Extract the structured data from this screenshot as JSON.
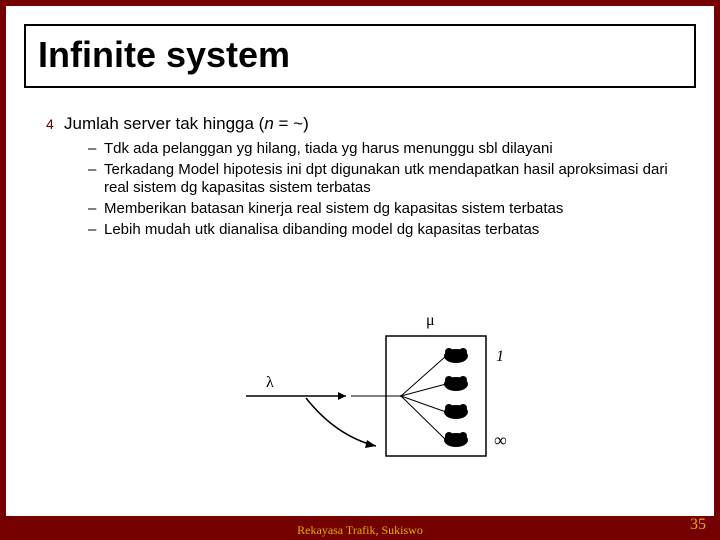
{
  "title": "Infinite system",
  "main_bullet": {
    "prefix": "Jumlah server tak hingga (",
    "varname": "n",
    "suffix": " = ~)"
  },
  "sub_bullets": [
    "Tdk ada pelanggan yg hilang, tiada yg harus menunggu sbl dilayani",
    "Terkadang Model hipotesis ini dpt digunakan utk mendapatkan hasil aproksimasi dari real sistem dg kapasitas sistem terbatas",
    "Memberikan batasan kinerja real sistem dg kapasitas sistem terbatas",
    "Lebih mudah utk dianalisa dibanding model dg kapasitas terbatas"
  ],
  "diagram": {
    "lambda": "λ",
    "mu": "μ",
    "one": "1",
    "infinity": "∞"
  },
  "footer": "Rekayasa Trafik, Sukiswo",
  "page_number": "35",
  "bullet1_glyph": "4",
  "bullet2_glyph": "–"
}
